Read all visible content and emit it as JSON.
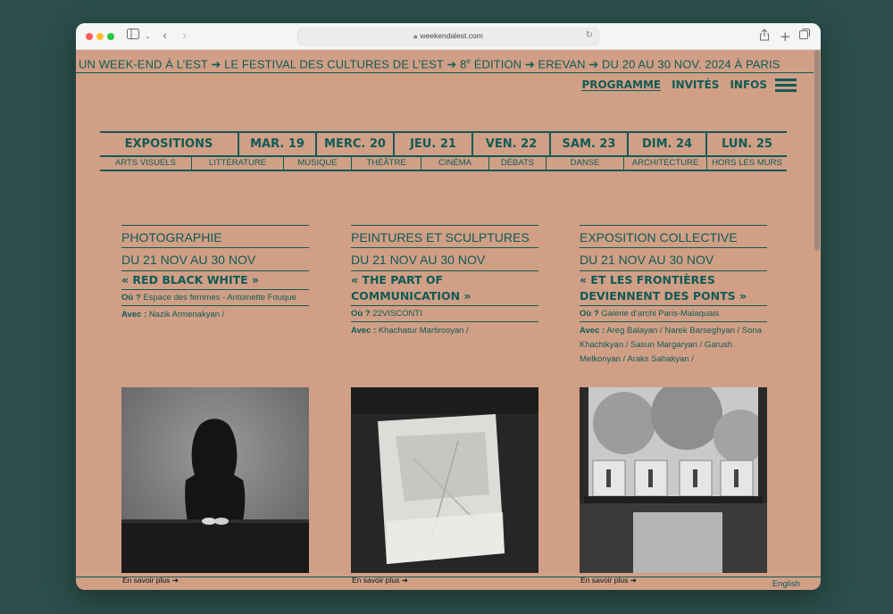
{
  "browser": {
    "url": "weekendalest.com"
  },
  "ticker": {
    "part1": "UN WEEK-END À L’EST ➔  LE FESTIVAL DES CULTURES DE L’EST ➔ 8",
    "sup": "e",
    "part2": " ÉDITION  ➔ EREVAN ➔ DU 20 AU 30 NOV. 2024 À PARIS"
  },
  "nav": {
    "programme": "PROGRAMME",
    "invites": "INVITÉS",
    "infos": "INFOS"
  },
  "days": [
    "EXPOSITIONS",
    "MAR. 19",
    "MERC. 20",
    "JEU. 21",
    "VEN. 22",
    "SAM. 23",
    "DIM. 24",
    "LUN. 25"
  ],
  "categories": [
    "ARTS VISUELS",
    "LITTÉRATURE",
    "MUSIQUE",
    "THÉÂTRE",
    "CINÉMA",
    "DÉBATS",
    "DANSE",
    "ARCHITECTURE",
    "HORS LES MURS"
  ],
  "events": [
    {
      "category": "PHOTOGRAPHIE",
      "dates": "DU 21 NOV AU 30 NOV",
      "title": "« RED BLACK WHITE »",
      "where_label": "Où ?",
      "where": "Espace des femmes - Antoinette Fouque",
      "with_label": "Avec :",
      "with": "Nazik Armenakyan /",
      "more": "En savoir plus ➔"
    },
    {
      "category": "PEINTURES ET SCULPTURES",
      "dates": "DU 21 NOV AU 30 NOV",
      "title": "« THE PART OF COMMUNICATION »",
      "where_label": "Où ?",
      "where": "22VISCONTI",
      "with_label": "Avec :",
      "with": "Khachatur Martirosyan /",
      "more": "En savoir plus ➔"
    },
    {
      "category": "EXPOSITION COLLECTIVE",
      "dates": "DU 21 NOV AU 30 NOV",
      "title": "« ET LES FRONTIÈRES DEVIENNENT DES PONTS »",
      "where_label": "Où ?",
      "where": "Galerie d’archi Paris-Malaquais",
      "with_label": "Avec :",
      "with": "Areg Balayan / Narek Barseghyan / Sona Khachikyan / Sasun Margaryan / Garush Melkonyan / Araks Sahakyan /",
      "more": "En savoir plus ➔"
    }
  ],
  "footer": {
    "language": "English"
  },
  "colors": {
    "background": "#d09f86",
    "accent": "#0f5b55",
    "desktop": "#2b4e4a"
  }
}
